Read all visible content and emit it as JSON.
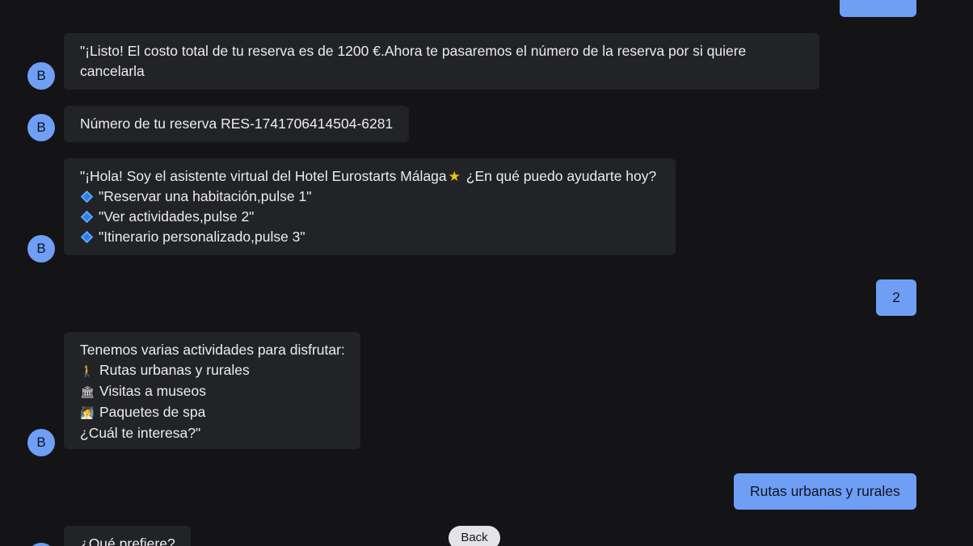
{
  "avatar_letter": "B",
  "messages": {
    "m1": {
      "text": "\"¡Listo! El costo total de tu reserva es de 1200 €.Ahora te pasaremos el número de la reserva por si quiere cancelarla"
    },
    "m2": {
      "text": "Número de tu reserva RES-1741706414504-6281"
    },
    "m3": {
      "greeting_a": "\"¡Hola! Soy el asistente virtual del Hotel Eurostarts Málaga",
      "greeting_b": "¿En qué puedo ayudarte hoy?",
      "options": [
        "\"Reservar una habitación,pulse 1\"",
        "\"Ver actividades,pulse 2\"",
        "\"Itinerario personalizado,pulse 3\""
      ]
    },
    "user1": {
      "text": "2"
    },
    "m4": {
      "intro": "Tenemos varias actividades para disfrutar:",
      "items": [
        "Rutas urbanas y rurales",
        "Visitas a museos",
        "Paquetes de spa"
      ],
      "question": "¿Cuál te interesa?\""
    },
    "user2": {
      "text": "Rutas urbanas y rurales"
    },
    "m5": {
      "text": "¿Qué prefiere?"
    }
  },
  "icons": {
    "greeting_icon": "star-icon",
    "option_icon": "blue-diamond-icon",
    "activity_icons": [
      "person-walking-icon",
      "museum-icon",
      "spa-person-icon"
    ]
  },
  "colors": {
    "background": "#141416",
    "bot_bubble": "#222327",
    "user_bubble": "#6f9ef5",
    "avatar": "#6f9ef5"
  },
  "back_button": {
    "label": "Back"
  }
}
